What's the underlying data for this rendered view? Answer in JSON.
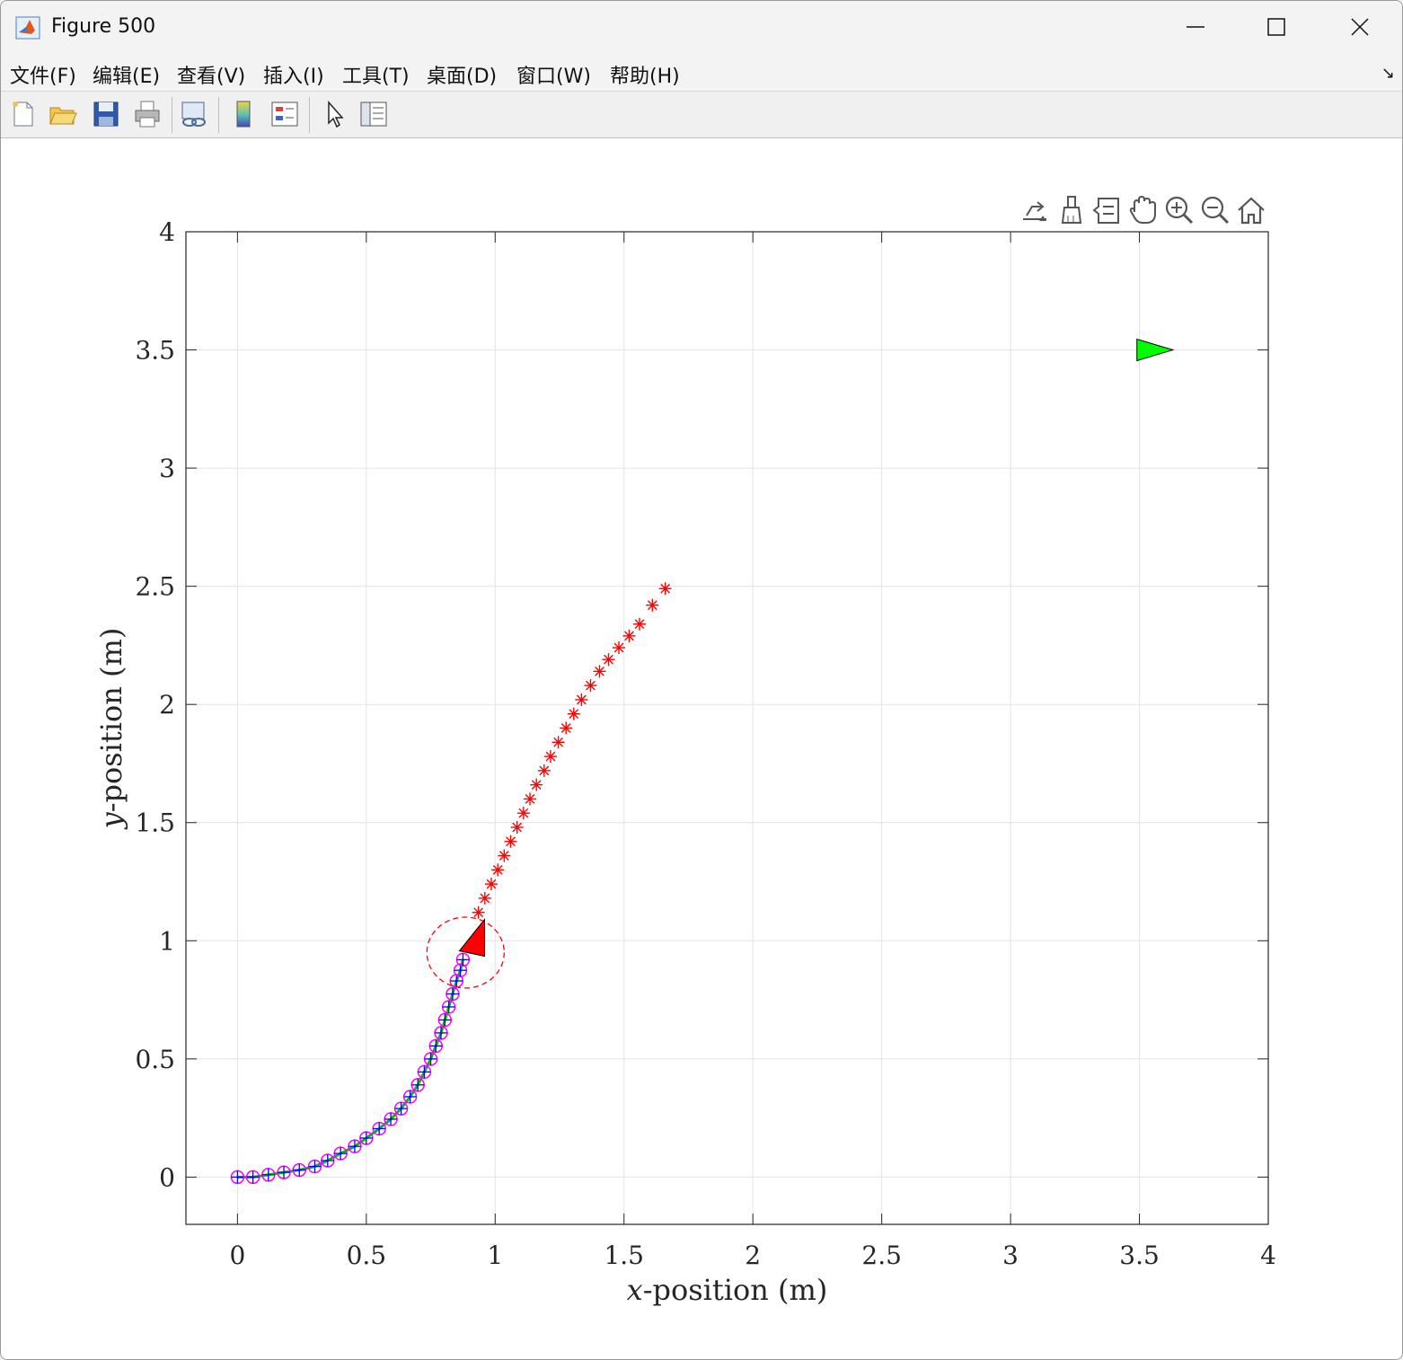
{
  "window": {
    "title": "Figure 500"
  },
  "menu": [
    "文件(F)",
    "编辑(E)",
    "查看(V)",
    "插入(I)",
    "工具(T)",
    "桌面(D)",
    "窗口(W)",
    "帮助(H)"
  ],
  "toolbar_icons": [
    "new-figure-icon",
    "open-icon",
    "save-icon",
    "print-icon",
    "link-plot-icon",
    "colorbar-icon",
    "legend-icon",
    "pointer-icon",
    "property-inspector-icon"
  ],
  "axes_toolbar_icons": [
    "export-icon",
    "brush-icon",
    "data-tips-icon",
    "pan-icon",
    "zoom-in-icon",
    "zoom-out-icon",
    "home-icon"
  ],
  "chart_data": {
    "type": "scatter",
    "xlabel_var": "x",
    "xlabel_rest": "-position (m)",
    "ylabel_var": "y",
    "ylabel_rest": "-position (m)",
    "xlim": [
      -0.2,
      4
    ],
    "ylim": [
      -0.2,
      4
    ],
    "xticks": [
      0,
      0.5,
      1,
      1.5,
      2,
      2.5,
      3,
      3.5,
      4
    ],
    "xtick_labels": [
      "0",
      "0.5",
      "1",
      "1.5",
      "2",
      "2.5",
      "3",
      "3.5",
      "4"
    ],
    "yticks": [
      0,
      0.5,
      1,
      1.5,
      2,
      2.5,
      3,
      3.5,
      4
    ],
    "ytick_labels": [
      "0",
      "0.5",
      "1",
      "1.5",
      "2",
      "2.5",
      "3",
      "3.5",
      "4"
    ],
    "grid": true,
    "series": [
      {
        "marker": "o+",
        "color": "#ff00ff",
        "line_color": "#00c000",
        "x": [
          0,
          0.06,
          0.12,
          0.18,
          0.24,
          0.3,
          0.35,
          0.4,
          0.455,
          0.5,
          0.55,
          0.595,
          0.635,
          0.67,
          0.7,
          0.725,
          0.75,
          0.77,
          0.79,
          0.805,
          0.82,
          0.835,
          0.85,
          0.865,
          0.875
        ],
        "y": [
          0,
          0.0,
          0.01,
          0.02,
          0.03,
          0.045,
          0.07,
          0.1,
          0.13,
          0.165,
          0.205,
          0.245,
          0.29,
          0.34,
          0.39,
          0.445,
          0.5,
          0.555,
          0.61,
          0.665,
          0.72,
          0.775,
          0.83,
          0.875,
          0.92
        ]
      },
      {
        "marker": "*",
        "color": "#ff0000",
        "x": [
          0.935,
          0.96,
          0.985,
          1.01,
          1.035,
          1.06,
          1.085,
          1.11,
          1.135,
          1.16,
          1.19,
          1.215,
          1.245,
          1.275,
          1.305,
          1.335,
          1.37,
          1.405,
          1.44,
          1.48,
          1.52,
          1.56,
          1.61,
          1.66
        ],
        "y": [
          1.12,
          1.18,
          1.24,
          1.3,
          1.36,
          1.42,
          1.48,
          1.54,
          1.6,
          1.66,
          1.72,
          1.78,
          1.84,
          1.9,
          1.96,
          2.02,
          2.08,
          2.14,
          2.19,
          2.24,
          2.29,
          2.34,
          2.42,
          2.49
        ]
      }
    ],
    "robot": {
      "x": 0.91,
      "y": 0.98,
      "color": "#ff0000"
    },
    "robot_circle": {
      "x": 0.885,
      "y": 0.95,
      "radius": 0.15,
      "color": "#ff0000"
    },
    "goal": {
      "x": 3.56,
      "y": 3.5,
      "color": "#00ff00"
    }
  }
}
